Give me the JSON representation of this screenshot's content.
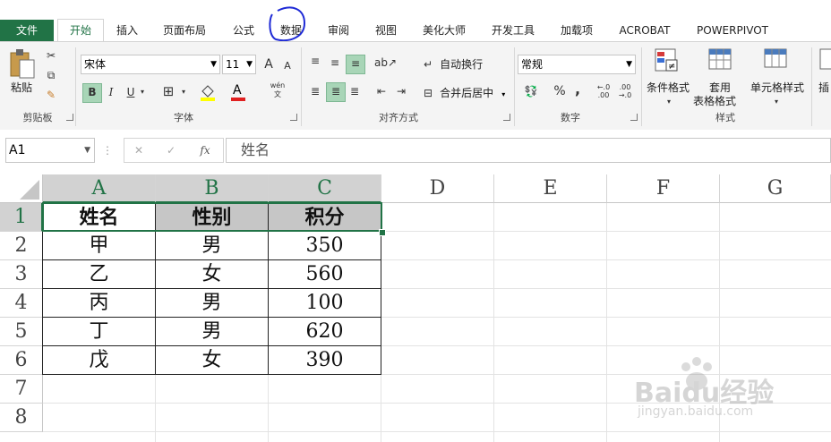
{
  "tabs": {
    "file": "文件",
    "home": "开始",
    "insert": "插入",
    "page_layout": "页面布局",
    "formulas": "公式",
    "data": "数据",
    "review": "审阅",
    "view": "视图",
    "meihua": "美化大师",
    "developer": "开发工具",
    "addins": "加载项",
    "acrobat": "ACROBAT",
    "powerpivot": "POWERPIVOT"
  },
  "ribbon": {
    "clipboard": {
      "paste": "粘贴",
      "label": "剪贴板"
    },
    "font": {
      "name": "宋体",
      "size": "11",
      "label": "字体",
      "bold": "B",
      "italic": "I",
      "underline": "U",
      "grow": "A",
      "shrink": "A",
      "font_color": "A",
      "phonetic": "wén"
    },
    "alignment": {
      "wrap": "自动换行",
      "merge": "合并后居中",
      "label": "对齐方式"
    },
    "number": {
      "format": "常规",
      "label": "数字",
      "percent": "%",
      "comma": ","
    },
    "styles": {
      "conditional": "条件格式",
      "table_line1": "套用",
      "table_line2": "表格格式",
      "cell_styles": "单元格样式",
      "label": "样式",
      "insert_partial": "插"
    }
  },
  "formula_bar": {
    "name_box": "A1",
    "fx": "fx",
    "value": "姓名"
  },
  "columns": [
    "A",
    "B",
    "C",
    "D",
    "E",
    "F",
    "G"
  ],
  "rows": [
    "1",
    "2",
    "3",
    "4",
    "5",
    "6",
    "7",
    "8"
  ],
  "table": {
    "headers": [
      "姓名",
      "性别",
      "积分"
    ],
    "rows": [
      [
        "甲",
        "男",
        "350"
      ],
      [
        "乙",
        "女",
        "560"
      ],
      [
        "丙",
        "男",
        "100"
      ],
      [
        "丁",
        "男",
        "620"
      ],
      [
        "戊",
        "女",
        "390"
      ]
    ]
  },
  "watermark": {
    "brand": "Baidu经验",
    "url": "jingyan.baidu.com"
  }
}
